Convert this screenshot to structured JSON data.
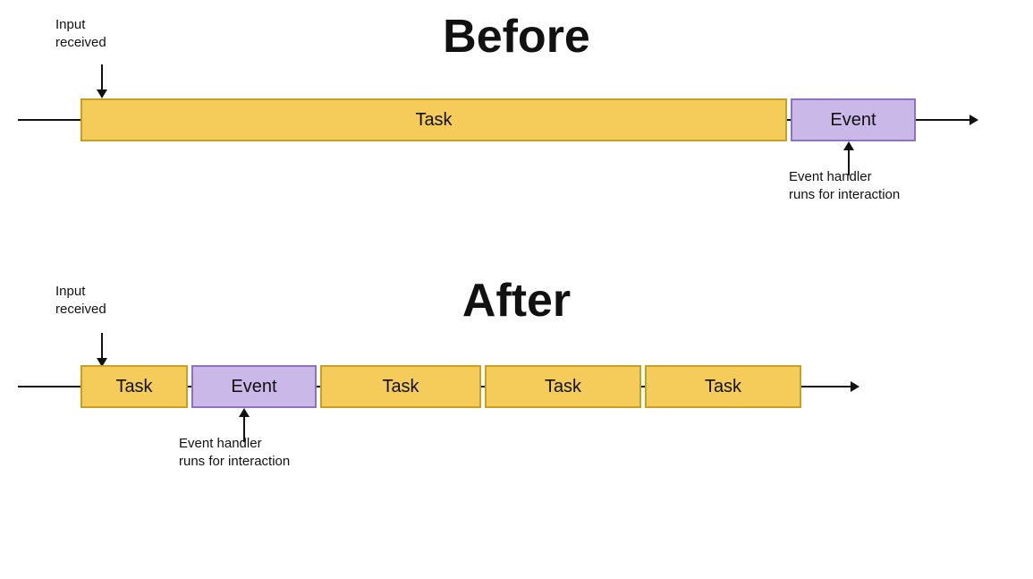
{
  "before": {
    "title": "Before",
    "input_label": "Input\nreceived",
    "event_handler_label": "Event handler\nruns for interaction",
    "task_label": "Task",
    "event_label": "Event"
  },
  "after": {
    "title": "After",
    "input_label": "Input\nreceived",
    "event_handler_label": "Event handler\nruns for interaction",
    "task_label": "Task",
    "event_label": "Event"
  }
}
